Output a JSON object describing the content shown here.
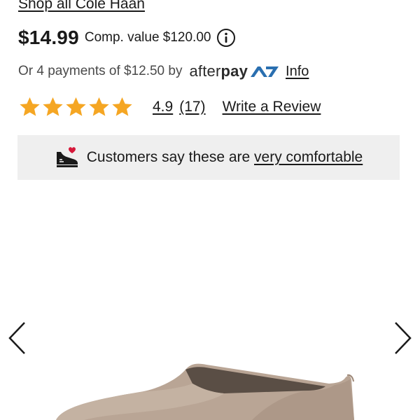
{
  "brand_link": "Shop all Cole Haan",
  "price": {
    "current": "$14.99",
    "comp_value": "Comp. value $120.00",
    "info_icon": "info-circle-icon"
  },
  "afterpay": {
    "text": "Or 4 payments of $12.50 by",
    "logo_light": "after",
    "logo_bold": "pay",
    "info_link": "Info",
    "mark_color": "#2a6fb0"
  },
  "rating": {
    "stars_filled": 5,
    "stars_total": 5,
    "star_color": "#f5a623",
    "score": "4.9",
    "count": "(17)",
    "write_review": "Write a Review"
  },
  "banner": {
    "icon": "sneaker-heart-icon",
    "heart_color": "#d6183a",
    "text_prefix": "Customers say these are ",
    "text_link": "very comfortable",
    "background": "#efefef"
  },
  "carousel": {
    "prev_icon": "chevron-left-icon",
    "next_icon": "chevron-right-icon",
    "product_image": "taupe suede loafer shoe"
  }
}
